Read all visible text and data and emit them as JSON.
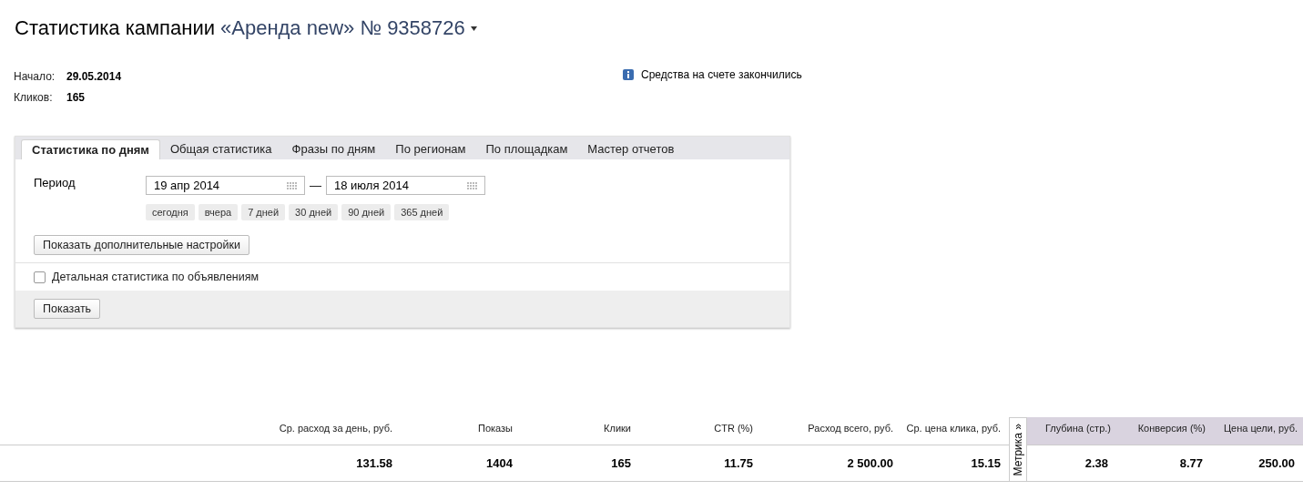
{
  "title": {
    "prefix": "Статистика кампании",
    "campaign": "«Аренда new» № 9358726"
  },
  "info": [
    {
      "label": "Начало:",
      "value": "29.05.2014"
    },
    {
      "label": "Кликов:",
      "value": "165"
    }
  ],
  "notice": "Средства на счете закончились",
  "tabs": [
    {
      "label": "Статистика по дням",
      "selected": true
    },
    {
      "label": "Общая статистика",
      "selected": false
    },
    {
      "label": "Фразы по дням",
      "selected": false
    },
    {
      "label": "По регионам",
      "selected": false
    },
    {
      "label": "По площадкам",
      "selected": false
    },
    {
      "label": "Мастер отчетов",
      "selected": false
    }
  ],
  "period": {
    "label": "Период",
    "from": "19 апр 2014",
    "separator": "—",
    "to": "18 июля 2014",
    "presets": [
      "сегодня",
      "вчера",
      "7 дней",
      "30 дней",
      "90 дней",
      "365 дней"
    ]
  },
  "more_settings_button": "Показать дополнительные настройки",
  "detail_checkbox": {
    "label": "Детальная статистика по объявлениям",
    "checked": false
  },
  "show_button": "Показать",
  "table": {
    "metrika_tab": "Метрика »",
    "columns": [
      {
        "label": "Ср. расход за день, руб.",
        "metrika": false
      },
      {
        "label": "Показы",
        "metrika": false
      },
      {
        "label": "Клики",
        "metrika": false
      },
      {
        "label": "CTR (%)",
        "metrika": false
      },
      {
        "label": "Расход всего, руб.",
        "metrika": false
      },
      {
        "label": "Ср. цена клика, руб.",
        "metrika": false
      },
      {
        "label": "Глубина (стр.)",
        "metrika": true
      },
      {
        "label": "Конверсия (%)",
        "metrika": true
      },
      {
        "label": "Цена цели, руб.",
        "metrika": true
      }
    ],
    "row": [
      "131.58",
      "1404",
      "165",
      "11.75",
      "2 500.00",
      "15.15",
      "2.38",
      "8.77",
      "250.00"
    ]
  }
}
